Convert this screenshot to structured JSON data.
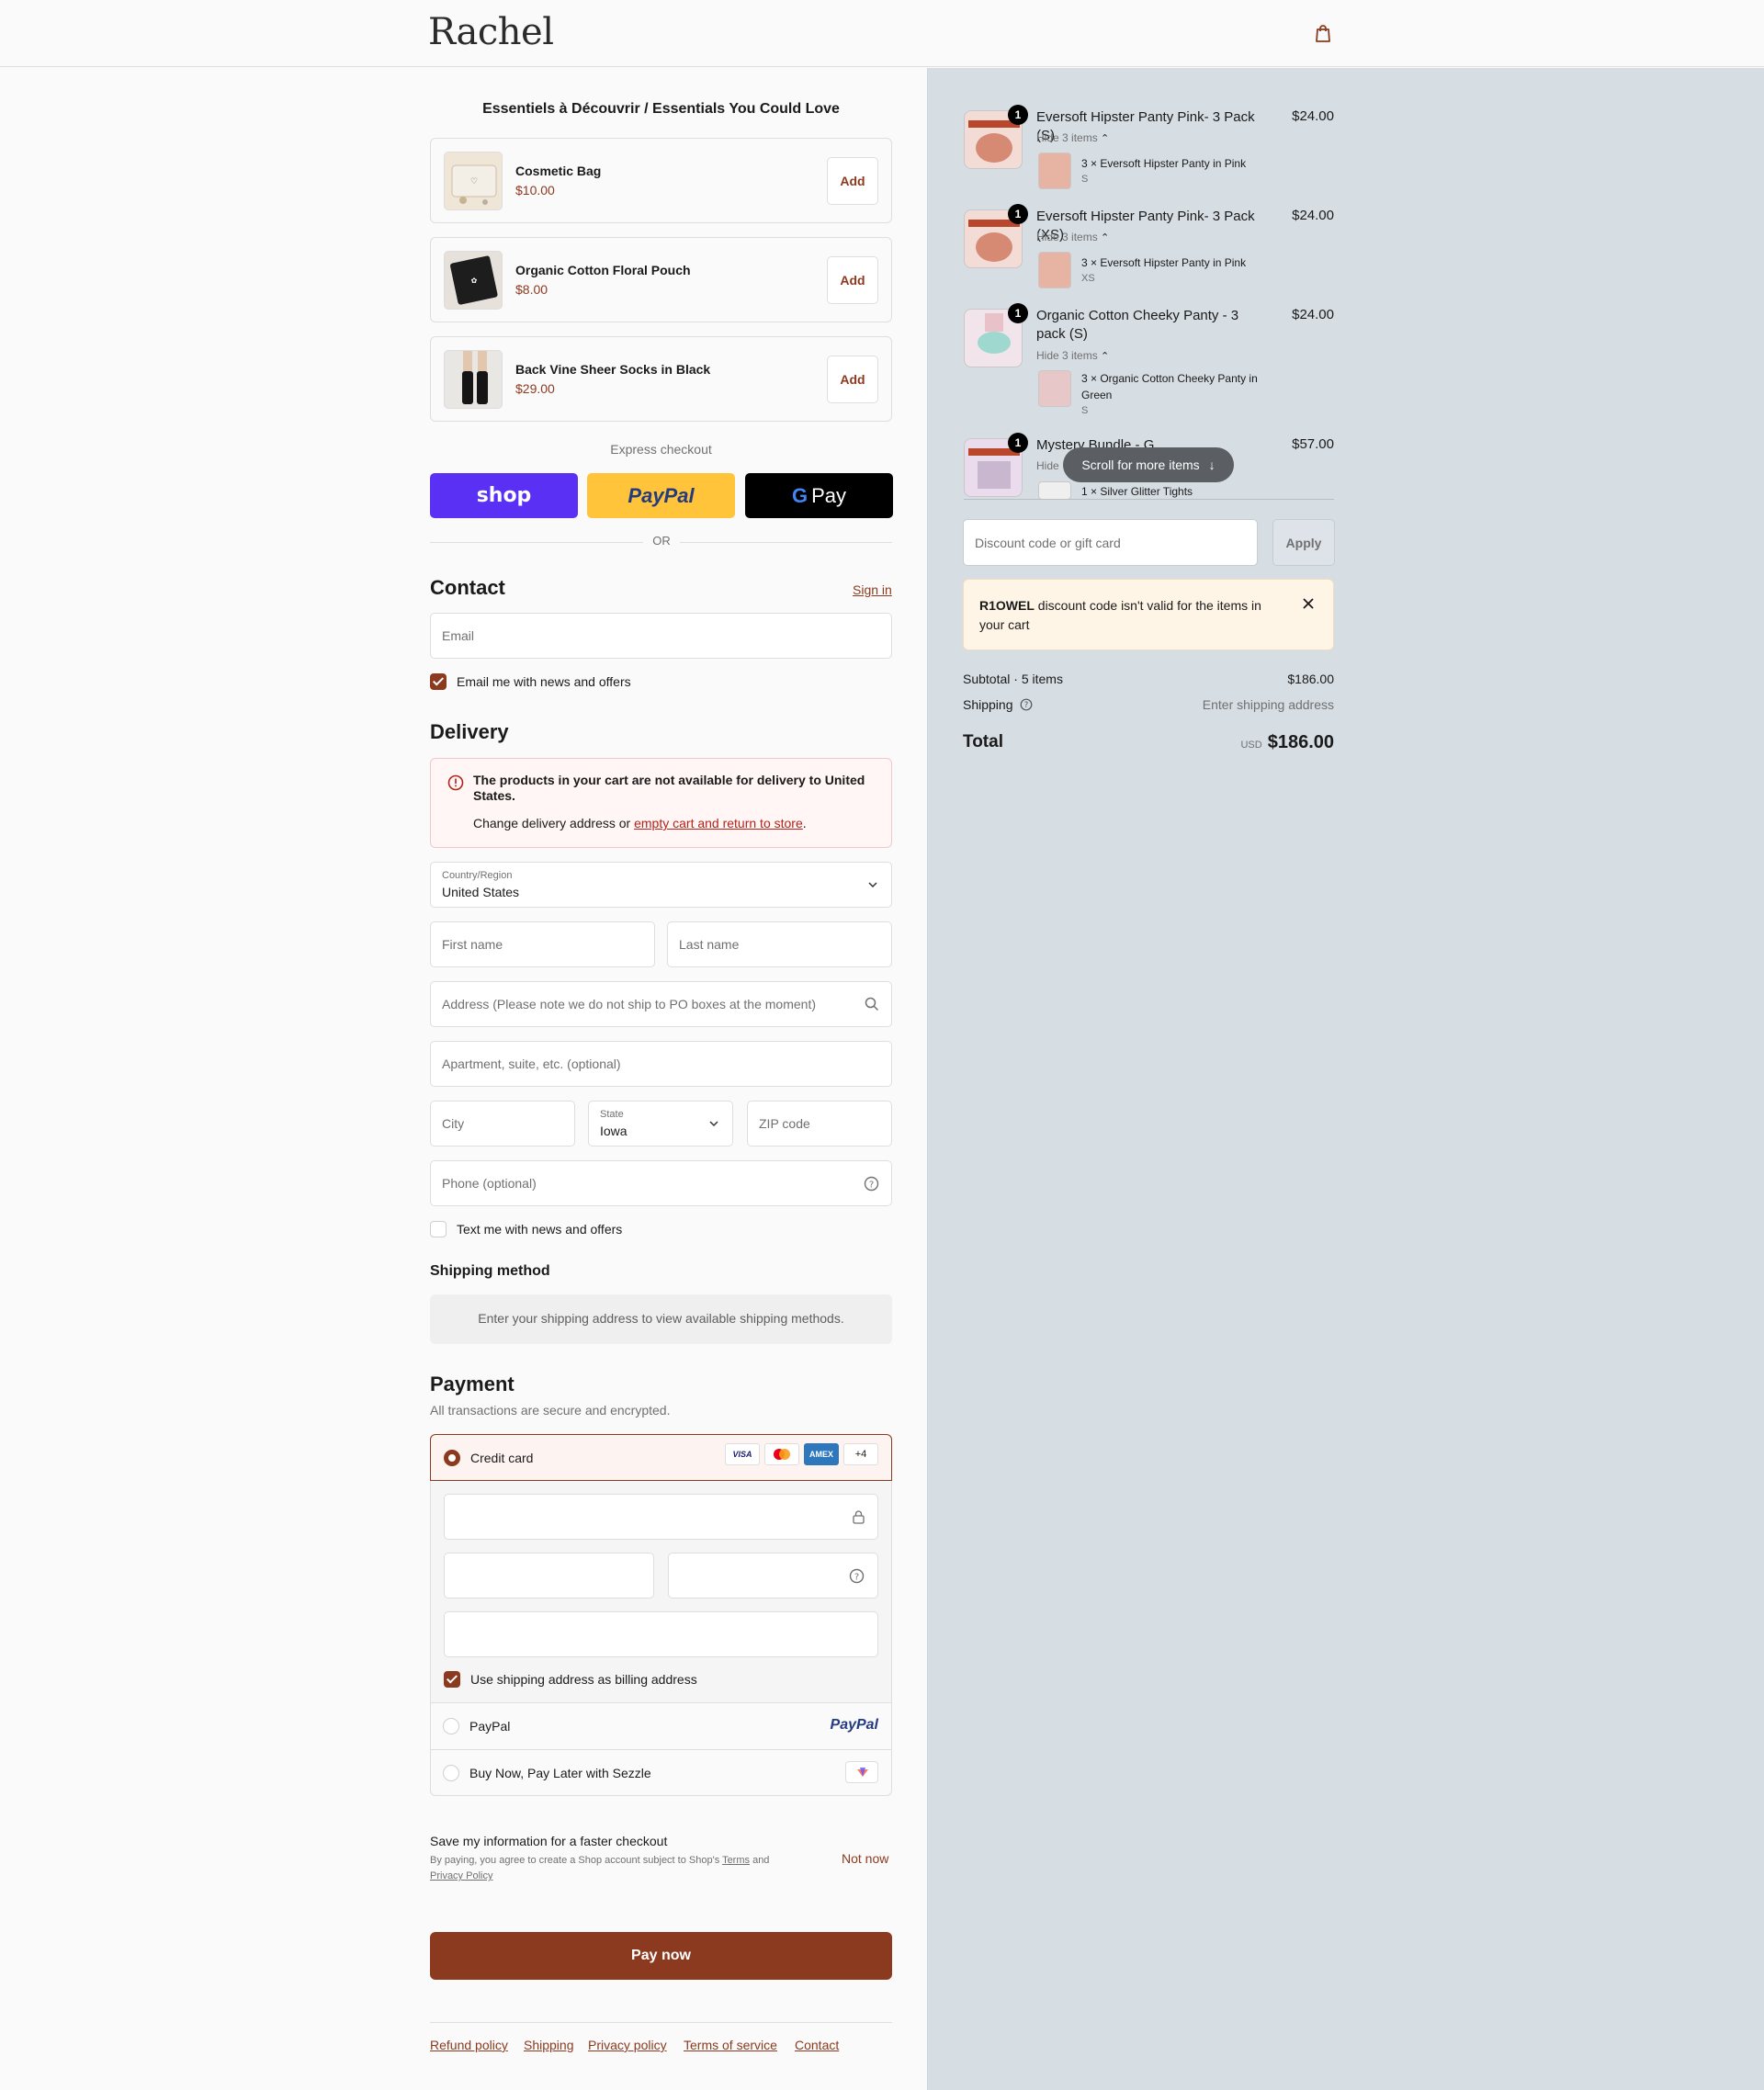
{
  "brand": {
    "logo": "Rachel",
    "accent": "#8b3a1f"
  },
  "upsell": {
    "title": "Essentiels à Découvrir / Essentials You Could Love",
    "items": [
      {
        "name": "Cosmetic Bag",
        "price": "$10.00",
        "add": "Add"
      },
      {
        "name": "Organic Cotton Floral Pouch",
        "price": "$8.00",
        "add": "Add"
      },
      {
        "name": "Back Vine Sheer Socks in Black",
        "price": "$29.00",
        "add": "Add"
      }
    ]
  },
  "express": {
    "label": "Express checkout",
    "shop": "shop",
    "paypal": "PayPal",
    "gpay": "Pay",
    "or": "OR"
  },
  "contact": {
    "title": "Contact",
    "sign_in": "Sign in",
    "email_placeholder": "Email",
    "news_label": "Email me with news and offers",
    "news_checked": true
  },
  "delivery": {
    "title": "Delivery",
    "alert_title": "The products in your cart are not available for delivery to United States.",
    "alert_text": "Change delivery address or ",
    "alert_link": "empty cart and return to store",
    "alert_end": ".",
    "country_label": "Country/Region",
    "country_value": "United States",
    "first_name": "First name",
    "last_name": "Last name",
    "address": "Address (Please note we do not ship to PO boxes at the moment)",
    "apartment": "Apartment, suite, etc. (optional)",
    "city": "City",
    "state_label": "State",
    "state_value": "Iowa",
    "zip": "ZIP code",
    "phone": "Phone (optional)",
    "text_label": "Text me with news and offers",
    "text_checked": false
  },
  "shipping_method": {
    "title": "Shipping method",
    "note": "Enter your shipping address to view available shipping methods."
  },
  "payment": {
    "title": "Payment",
    "subtitle": "All transactions are secure and encrypted.",
    "credit_card": "Credit card",
    "more_brands": "+4",
    "brands": [
      "VISA",
      "mastercard",
      "AMEX"
    ],
    "billing_label": "Use shipping address as billing address",
    "billing_checked": true,
    "paypal": "PayPal",
    "sezzle": "Buy Now, Pay Later with Sezzle"
  },
  "save_info": {
    "title": "Save my information for a faster checkout",
    "legal_1": "By paying, you agree to create a Shop account subject to Shop's ",
    "terms": "Terms",
    "legal_2": " and",
    "privacy": "Privacy Policy",
    "not_now": "Not now"
  },
  "pay_now": "Pay now",
  "footer": {
    "links": [
      "Refund policy",
      "Shipping",
      "Privacy policy",
      "Terms of service",
      "Contact"
    ]
  },
  "cart": {
    "items": [
      {
        "qty": "1",
        "name": "Eversoft Hipster Panty Pink- 3 Pack (S)",
        "price": "$24.00",
        "hide": "Hide 3 items",
        "sub_name": "3 × Eversoft Hipster Panty in Pink",
        "sub_var": "S"
      },
      {
        "qty": "1",
        "name": "Eversoft Hipster Panty Pink- 3 Pack (XS)",
        "price": "$24.00",
        "hide": "Hide 3 items",
        "sub_name": "3 × Eversoft Hipster Panty in Pink",
        "sub_var": "XS"
      },
      {
        "qty": "1",
        "name": "Organic Cotton Cheeky Panty - 3 pack (S)",
        "price": "$24.00",
        "hide": "Hide 3 items",
        "sub_name": "3 × Organic Cotton Cheeky Panty in Green",
        "sub_var": "S"
      },
      {
        "qty": "1",
        "name": "Mystery Bundle - G",
        "price": "$57.00",
        "hide": "Hide",
        "sub_name": "1 × Silver Glitter Tights",
        "sub_var": ""
      }
    ],
    "scroll_hint": "Scroll for more items",
    "discount_placeholder": "Discount code or gift card",
    "apply": "Apply",
    "discount_error_code": "R1OWEL",
    "discount_error_text": " discount code isn't valid for the items in your cart",
    "subtotal_label": "Subtotal · 5 items",
    "subtotal_value": "$186.00",
    "shipping_label": "Shipping",
    "shipping_value": "Enter shipping address",
    "total_label": "Total",
    "currency": "USD",
    "total_value": "$186.00"
  }
}
